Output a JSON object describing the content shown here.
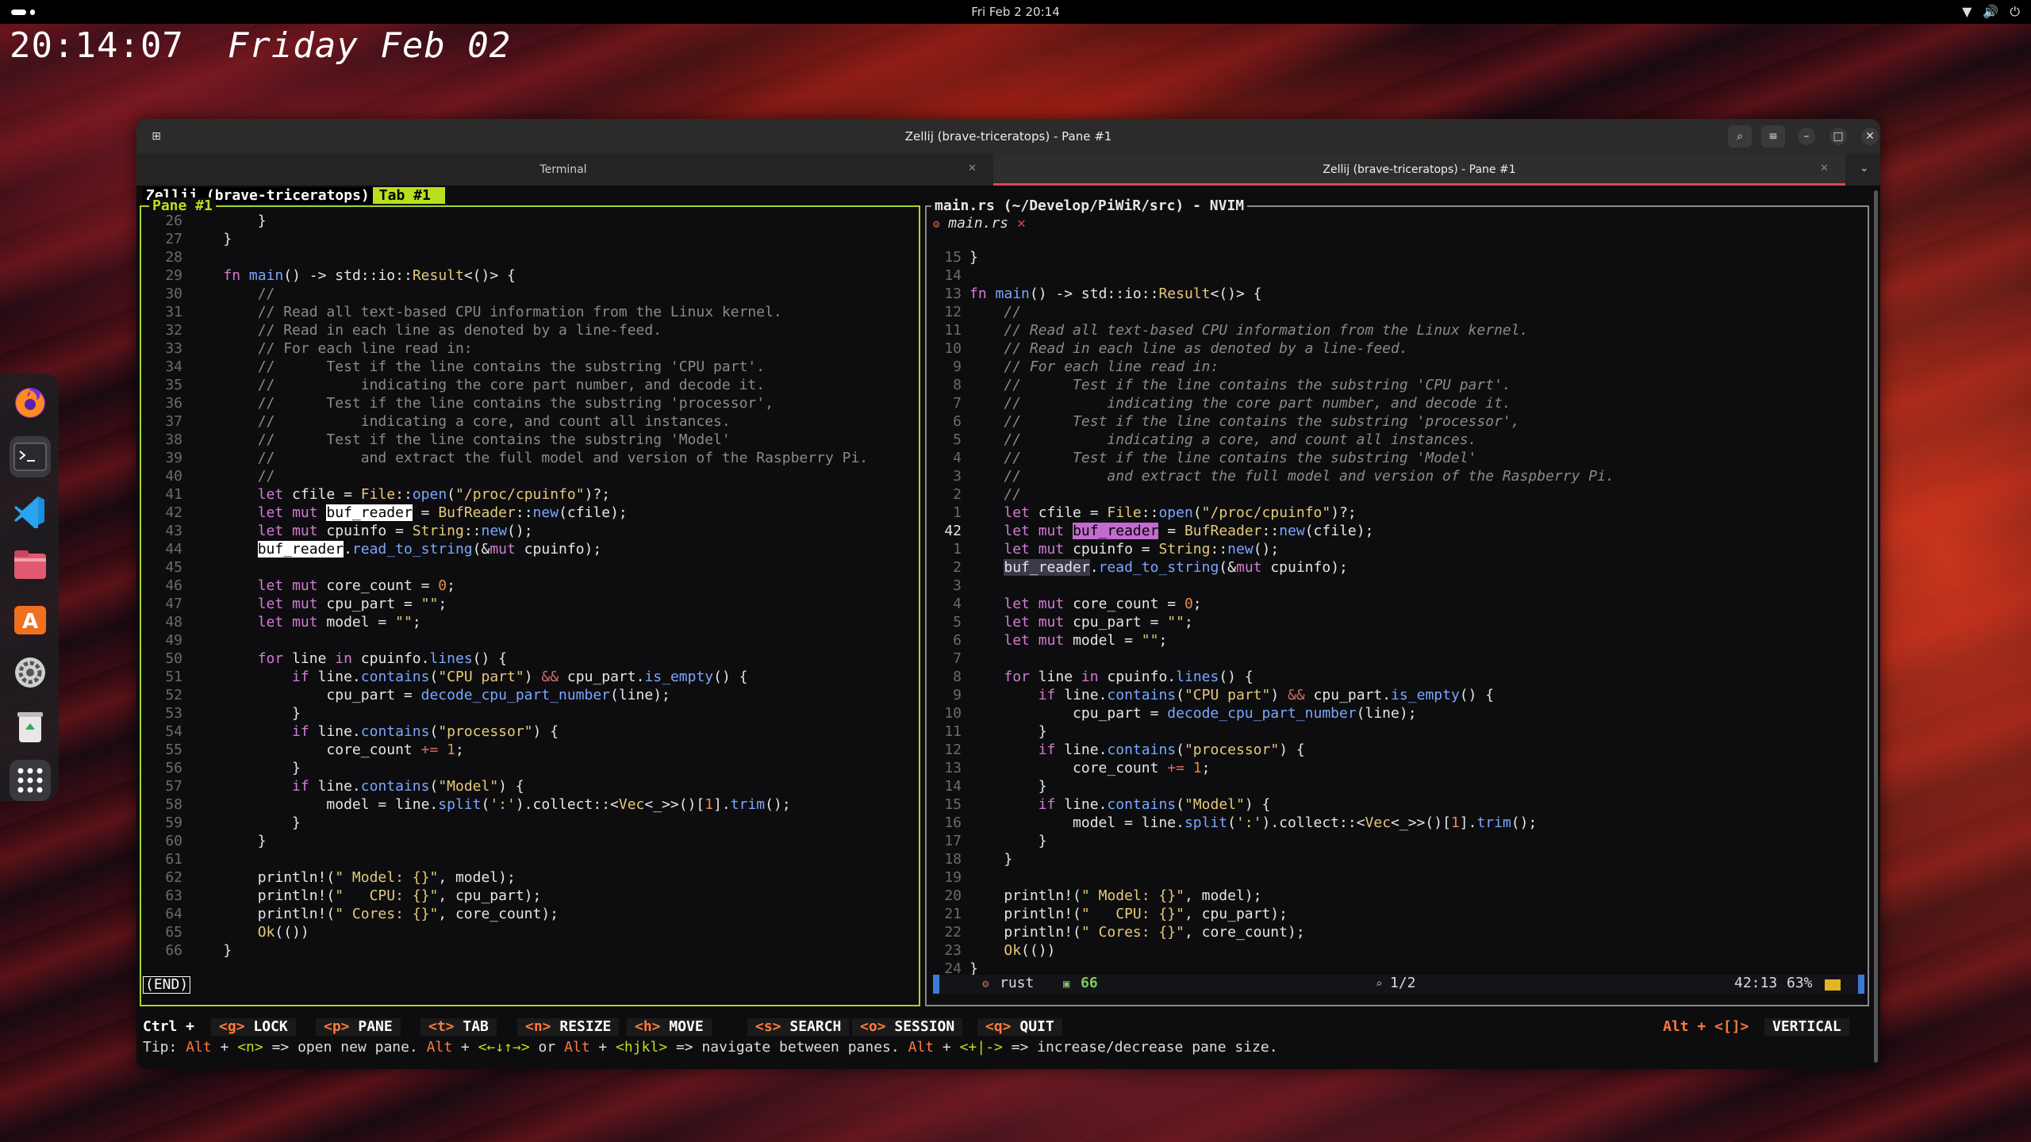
{
  "topbar": {
    "clock": "Fri Feb 2  20:14"
  },
  "desktop": {
    "time": "20:14:07",
    "date": "Friday Feb 02"
  },
  "dock": {
    "apps": [
      {
        "name": "Firefox",
        "icon": "firefox-icon"
      },
      {
        "name": "Terminal",
        "icon": "terminal-icon"
      },
      {
        "name": "Visual Studio Code",
        "icon": "vscode-icon"
      },
      {
        "name": "Files",
        "icon": "files-icon"
      },
      {
        "name": "App Center",
        "icon": "app-center-icon"
      },
      {
        "name": "Settings",
        "icon": "settings-icon"
      },
      {
        "name": "Trash",
        "icon": "trash-icon"
      },
      {
        "name": "Show Apps",
        "icon": "grid-icon"
      }
    ]
  },
  "window": {
    "title": "Zellij (brave-triceratops) - Pane #1",
    "tabs": [
      {
        "label": "Terminal",
        "active": false
      },
      {
        "label": "Zellij (brave-triceratops) - Pane #1",
        "active": true
      }
    ]
  },
  "zellij": {
    "session": "Zellij (brave-triceratops)",
    "tab": "Tab #1",
    "left_pane_title": "Pane #1",
    "right_pane_title": "main.rs (~/Develop/PiWiR/src) - NVIM",
    "pager_status": "(END)",
    "keybar": {
      "prefix": "Ctrl +",
      "keys": [
        {
          "key": "<g>",
          "label": "LOCK"
        },
        {
          "key": "<p>",
          "label": "PANE"
        },
        {
          "key": "<t>",
          "label": "TAB"
        },
        {
          "key": "<n>",
          "label": "RESIZE"
        },
        {
          "key": "<h>",
          "label": "MOVE"
        },
        {
          "key": "<s>",
          "label": "SEARCH"
        },
        {
          "key": "<o>",
          "label": "SESSION"
        },
        {
          "key": "<q>",
          "label": "QUIT"
        }
      ],
      "right_key": "Alt + <[]>",
      "right_label": "VERTICAL"
    },
    "tip": {
      "p1": "Tip: ",
      "a1": "Alt",
      "p2": " + ",
      "g1": "<n>",
      "p3": " => open new pane. ",
      "a2": "Alt",
      "p4": " + ",
      "g2": "<←↓↑→>",
      "p5": " or ",
      "a3": "Alt",
      "p6": " + ",
      "g3": "<hjkl>",
      "p7": " => navigate between panes. ",
      "a4": "Alt",
      "p8": " + ",
      "g4": "<+|->",
      "p9": " => increase/decrease pane size."
    }
  },
  "nvim": {
    "buffer_tab": "main.rs",
    "status": {
      "filetype": "rust",
      "diagnostics": "66",
      "search": "1/2",
      "position": "42:13",
      "percent": "63%"
    }
  },
  "left_code": [
    {
      "n": "26",
      "t": "        }"
    },
    {
      "n": "27",
      "t": "    }"
    },
    {
      "n": "28",
      "t": ""
    },
    {
      "n": "29",
      "t": "    fn main() -> std::io::Result<()> {"
    },
    {
      "n": "30",
      "t": "        //"
    },
    {
      "n": "31",
      "t": "        // Read all text-based CPU information from the Linux kernel."
    },
    {
      "n": "32",
      "t": "        // Read in each line as denoted by a line-feed."
    },
    {
      "n": "33",
      "t": "        // For each line read in:"
    },
    {
      "n": "34",
      "t": "        //      Test if the line contains the substring 'CPU part'."
    },
    {
      "n": "35",
      "t": "        //          indicating the core part number, and decode it."
    },
    {
      "n": "36",
      "t": "        //      Test if the line contains the substring 'processor',"
    },
    {
      "n": "37",
      "t": "        //          indicating a core, and count all instances."
    },
    {
      "n": "38",
      "t": "        //      Test if the line contains the substring 'Model'"
    },
    {
      "n": "39",
      "t": "        //          and extract the full model and version of the Raspberry Pi."
    },
    {
      "n": "40",
      "t": "        //"
    },
    {
      "n": "41",
      "t": "        let cfile = File::open(\"/proc/cpuinfo\")?;"
    },
    {
      "n": "42",
      "t": "        let mut buf_reader = BufReader::new(cfile);"
    },
    {
      "n": "43",
      "t": "        let mut cpuinfo = String::new();"
    },
    {
      "n": "44",
      "t": "        buf_reader.read_to_string(&mut cpuinfo);"
    },
    {
      "n": "45",
      "t": ""
    },
    {
      "n": "46",
      "t": "        let mut core_count = 0;"
    },
    {
      "n": "47",
      "t": "        let mut cpu_part = \"\";"
    },
    {
      "n": "48",
      "t": "        let mut model = \"\";"
    },
    {
      "n": "49",
      "t": ""
    },
    {
      "n": "50",
      "t": "        for line in cpuinfo.lines() {"
    },
    {
      "n": "51",
      "t": "            if line.contains(\"CPU part\") && cpu_part.is_empty() {"
    },
    {
      "n": "52",
      "t": "                cpu_part = decode_cpu_part_number(line);"
    },
    {
      "n": "53",
      "t": "            }"
    },
    {
      "n": "54",
      "t": "            if line.contains(\"processor\") {"
    },
    {
      "n": "55",
      "t": "                core_count += 1;"
    },
    {
      "n": "56",
      "t": "            }"
    },
    {
      "n": "57",
      "t": "            if line.contains(\"Model\") {"
    },
    {
      "n": "58",
      "t": "                model = line.split(':').collect::<Vec<_>>()[1].trim();"
    },
    {
      "n": "59",
      "t": "            }"
    },
    {
      "n": "60",
      "t": "        }"
    },
    {
      "n": "61",
      "t": ""
    },
    {
      "n": "62",
      "t": "        println!(\" Model: {}\", model);"
    },
    {
      "n": "63",
      "t": "        println!(\"   CPU: {}\", cpu_part);"
    },
    {
      "n": "64",
      "t": "        println!(\" Cores: {}\", core_count);"
    },
    {
      "n": "65",
      "t": "        Ok(())"
    },
    {
      "n": "66",
      "t": "    }"
    }
  ],
  "right_code": [
    {
      "n": "15",
      "t": "}"
    },
    {
      "n": "14",
      "t": ""
    },
    {
      "n": "13",
      "t": "fn main() -> std::io::Result<()> {"
    },
    {
      "n": "12",
      "t": "    //"
    },
    {
      "n": "11",
      "t": "    // Read all text-based CPU information from the Linux kernel."
    },
    {
      "n": "10",
      "t": "    // Read in each line as denoted by a line-feed."
    },
    {
      "n": "9",
      "t": "    // For each line read in:"
    },
    {
      "n": "8",
      "t": "    //      Test if the line contains the substring 'CPU part'."
    },
    {
      "n": "7",
      "t": "    //          indicating the core part number, and decode it."
    },
    {
      "n": "6",
      "t": "    //      Test if the line contains the substring 'processor',"
    },
    {
      "n": "5",
      "t": "    //          indicating a core, and count all instances."
    },
    {
      "n": "4",
      "t": "    //      Test if the line contains the substring 'Model'"
    },
    {
      "n": "3",
      "t": "    //          and extract the full model and version of the Raspberry Pi."
    },
    {
      "n": "2",
      "t": "    //"
    },
    {
      "n": "1",
      "t": "    let cfile = File::open(\"/proc/cpuinfo\")?;"
    },
    {
      "n": "42",
      "t": "    let mut buf_reader = BufReader::new(cfile);"
    },
    {
      "n": "1",
      "t": "    let mut cpuinfo = String::new();"
    },
    {
      "n": "2",
      "t": "    buf_reader.read_to_string(&mut cpuinfo);"
    },
    {
      "n": "3",
      "t": ""
    },
    {
      "n": "4",
      "t": "    let mut core_count = 0;"
    },
    {
      "n": "5",
      "t": "    let mut cpu_part = \"\";"
    },
    {
      "n": "6",
      "t": "    let mut model = \"\";"
    },
    {
      "n": "7",
      "t": ""
    },
    {
      "n": "8",
      "t": "    for line in cpuinfo.lines() {"
    },
    {
      "n": "9",
      "t": "        if line.contains(\"CPU part\") && cpu_part.is_empty() {"
    },
    {
      "n": "10",
      "t": "            cpu_part = decode_cpu_part_number(line);"
    },
    {
      "n": "11",
      "t": "        }"
    },
    {
      "n": "12",
      "t": "        if line.contains(\"processor\") {"
    },
    {
      "n": "13",
      "t": "            core_count += 1;"
    },
    {
      "n": "14",
      "t": "        }"
    },
    {
      "n": "15",
      "t": "        if line.contains(\"Model\") {"
    },
    {
      "n": "16",
      "t": "            model = line.split(':').collect::<Vec<_>>()[1].trim();"
    },
    {
      "n": "17",
      "t": "        }"
    },
    {
      "n": "18",
      "t": "    }"
    },
    {
      "n": "19",
      "t": ""
    },
    {
      "n": "20",
      "t": "    println!(\" Model: {}\", model);"
    },
    {
      "n": "21",
      "t": "    println!(\"   CPU: {}\", cpu_part);"
    },
    {
      "n": "22",
      "t": "    println!(\" Cores: {}\", core_count);"
    },
    {
      "n": "23",
      "t": "    Ok(())"
    },
    {
      "n": "24",
      "t": "}"
    }
  ],
  "colors": {
    "accent_green": "#b8e01e",
    "accent_orange": "#ff7a3a",
    "tab_underline": "#e0454a"
  }
}
